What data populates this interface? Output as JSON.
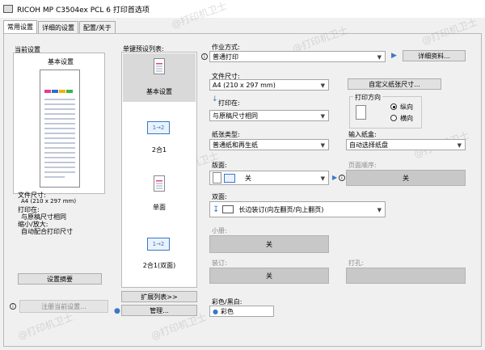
{
  "window": {
    "title": "RICOH MP C3504ex PCL 6 打印首选项"
  },
  "tabs": [
    {
      "label": "常用设置"
    },
    {
      "label": "详细的设置"
    },
    {
      "label": "配置/关于"
    }
  ],
  "left": {
    "current_settings_label": "当前设置",
    "preview_title": "基本设置",
    "paper_size_label": "文件尺寸:",
    "paper_size_value": "A4 (210 x 297 mm)",
    "print_on_label": "打印在:",
    "print_on_value": "与原稿尺寸相同",
    "reduce_label": "缩小/放大:",
    "reduce_value": "自动配合打印尺寸",
    "summary_button": "设置摘要",
    "register_button": "注册当前设置..."
  },
  "presets": {
    "label": "单键预设列表:",
    "items": [
      {
        "label": "基本设置",
        "icon_text": ""
      },
      {
        "label": "2合1",
        "icon_text": "1→2"
      },
      {
        "label": "单面",
        "icon_text": ""
      },
      {
        "label": "2合1(双面)",
        "icon_text": "1→2"
      }
    ],
    "expand_button": "扩展列表>>",
    "manage_button": "管理..."
  },
  "main": {
    "job_type_label": "作业方式:",
    "job_type_value": "普通打印",
    "details_button": "详细资料...",
    "doc_size_label": "文件尺寸:",
    "doc_size_value": "A4 (210 x 297 mm)",
    "custom_size_button": "自定义纸张尺寸...",
    "print_on_label": "打印在:",
    "print_on_value": "与原稿尺寸相同",
    "orientation_label": "打印方向",
    "portrait_label": "纵向",
    "landscape_label": "横向",
    "paper_type_label": "纸张类型:",
    "paper_type_value": "普通纸和再生纸",
    "input_tray_label": "输入纸盒:",
    "input_tray_value": "自动选择纸盘",
    "layout_label": "版面:",
    "layout_value": "关",
    "page_order_label": "页面顺序:",
    "page_order_value": "关",
    "duplex_label": "双面:",
    "duplex_value": "长边装订(向左翻页/向上翻页)",
    "booklet_label": "小册:",
    "booklet_value": "关",
    "staple_label": "装订:",
    "staple_value": "关",
    "punch_label": "打孔:",
    "color_label": "彩色/黑白:",
    "color_value": "彩色"
  },
  "watermark": {
    "text": "@打印机卫士"
  },
  "colors": {
    "accent": "#3a78c8",
    "selected": "#d9d9d9",
    "disabled": "#c8c8c8"
  }
}
